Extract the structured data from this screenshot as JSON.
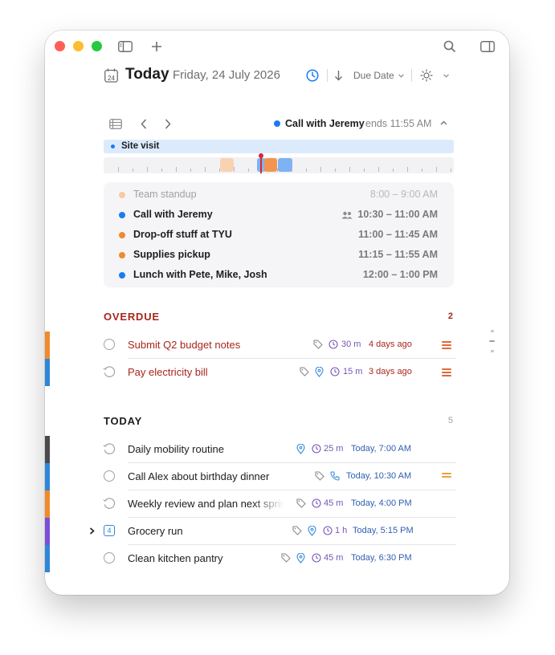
{
  "header": {
    "title": "Today",
    "date": "Friday, 24 July 2026",
    "calendar_day": "24",
    "sort_label": "Due Date"
  },
  "timeline": {
    "current_event": "Call with Jeremy",
    "current_event_end": "ends 11:55 AM",
    "all_day_event": "Site visit",
    "events": [
      {
        "title": "Team standup",
        "time": "8:00 – 9:00 AM",
        "color": "#f6caa6",
        "past": true,
        "shared": false
      },
      {
        "title": "Call with Jeremy",
        "time": "10:30 – 11:00 AM",
        "color": "#1a7bf2",
        "past": false,
        "shared": true
      },
      {
        "title": "Drop-off stuff at TYU",
        "time": "11:00 – 11:45 AM",
        "color": "#f08a2c",
        "past": false,
        "shared": false
      },
      {
        "title": "Supplies pickup",
        "time": "11:15 – 11:55 AM",
        "color": "#f08a2c",
        "past": false,
        "shared": false
      },
      {
        "title": "Lunch with Pete, Mike, Josh",
        "time": "12:00 – 1:00 PM",
        "color": "#1a7bf2",
        "past": false,
        "shared": false
      }
    ]
  },
  "overdue": {
    "label": "OVERDUE",
    "count": "2",
    "tasks": [
      {
        "title": "Submit Q2 budget notes",
        "duration": "30 m",
        "due": "4 days ago"
      },
      {
        "title": "Pay electricity bill",
        "duration": "15 m",
        "due": "3 days ago"
      }
    ]
  },
  "today": {
    "label": "TODAY",
    "count": "5",
    "tasks": [
      {
        "title": "Daily mobility routine",
        "duration": "25 m",
        "due": "Today, 7:00 AM"
      },
      {
        "title": "Call Alex about birthday dinner",
        "duration": "",
        "due": "Today, 10:30 AM"
      },
      {
        "title": "Weekly review and plan next sprint",
        "duration": "45 m",
        "due": "Today, 4:00 PM"
      },
      {
        "title": "Grocery run",
        "duration": "1 h",
        "due": "Today, 5:15 PM",
        "subtask_count": "4"
      },
      {
        "title": "Clean kitchen pantry",
        "duration": "45 m",
        "due": "Today, 6:30 PM"
      }
    ]
  },
  "colors": {
    "accent_blue": "#1a7bf2",
    "overdue_red": "#a8261c",
    "due_blue": "#2f5fb0",
    "duration_purple": "#7657b8",
    "priority_orange": "#e0693a"
  }
}
